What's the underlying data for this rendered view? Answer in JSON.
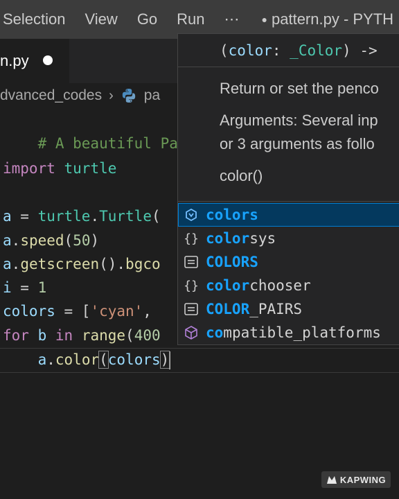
{
  "menubar": {
    "items": [
      "Selection",
      "View",
      "Go",
      "Run",
      "⋯"
    ],
    "title": "pattern.py - PYTH"
  },
  "tab": {
    "label": "n.py"
  },
  "breadcrumb": {
    "folder": "dvanced_codes",
    "file": "pa"
  },
  "code": {
    "comment": "# A beautiful Patt",
    "import_kw": "import",
    "import_mod": "turtle",
    "l4_var": "a",
    "l4_eq": " = ",
    "l4_mod": "turtle",
    "l4_dot": ".",
    "l4_cls": "Turtle",
    "l4_paren": "(",
    "l5_var": "a",
    "l5_dot": ".",
    "l5_fn": "speed",
    "l5_open": "(",
    "l5_num": "50",
    "l5_close": ")",
    "l6_var": "a",
    "l6_dot": ".",
    "l6_fn": "getscreen",
    "l6_mid": "().",
    "l6_fn2": "bgco",
    "l7_var": "i",
    "l7_eq": " = ",
    "l7_num": "1",
    "l8_var": "colors",
    "l8_eq": " = [",
    "l8_str": "'cyan'",
    "l8_comma": ",",
    "l9_kw": "for",
    "l9_var": " b ",
    "l9_in": "in",
    "l9_sp": " ",
    "l9_fn": "range",
    "l9_open": "(",
    "l9_num": "400",
    "l10_indent": "    ",
    "l10_var": "a",
    "l10_dot": ".",
    "l10_fn": "color",
    "l10_open": "(",
    "l10_arg": "colors",
    "l10_close": ")"
  },
  "hover": {
    "sig_open": "(",
    "sig_param": "color",
    "sig_colon": ": ",
    "sig_type": "_Color",
    "sig_close": ") ->",
    "doc1": "Return or set the penco",
    "doc2a": "Arguments: Several inp",
    "doc2b": "or 3 arguments as follo",
    "doc3": "color()"
  },
  "suggestions": [
    {
      "match": "colors",
      "rest": "",
      "icon": "variable-icon",
      "selected": true
    },
    {
      "match": "color",
      "rest": "sys",
      "icon": "module-icon",
      "selected": false
    },
    {
      "match": "COLORS",
      "rest": "",
      "icon": "constant-icon",
      "selected": false
    },
    {
      "match": "color",
      "rest": "chooser",
      "icon": "module-icon",
      "selected": false
    },
    {
      "match": "COLOR",
      "rest": "_PAIRS",
      "icon": "constant-icon",
      "selected": false
    },
    {
      "match": "co",
      "rest": "mpatible_platforms",
      "icon": "field-icon",
      "selected": false
    }
  ],
  "watermark": "KAPWING",
  "colors": {
    "accent": "#007fd4",
    "match_highlight": "#18a3ff",
    "editor_bg": "#1e1e1e",
    "widget_bg": "#252526"
  }
}
